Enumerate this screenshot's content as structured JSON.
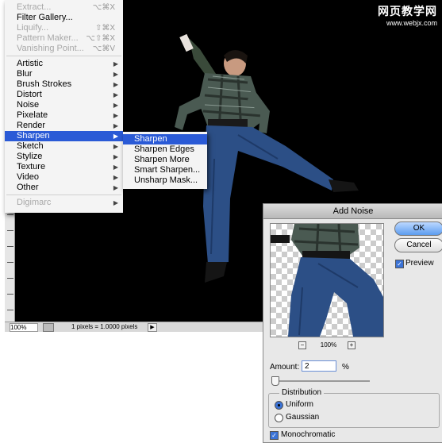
{
  "watermark": {
    "line1": "网页教学网",
    "line2": "www.webjx.com"
  },
  "menu": {
    "top_items": [
      {
        "label": "Extract...",
        "shortcut": "⌥⌘X",
        "disabled": true
      },
      {
        "label": "Filter Gallery...",
        "shortcut": "",
        "disabled": false
      },
      {
        "label": "Liquify...",
        "shortcut": "⇧⌘X",
        "disabled": true
      },
      {
        "label": "Pattern Maker...",
        "shortcut": "⌥⇧⌘X",
        "disabled": true
      },
      {
        "label": "Vanishing Point...",
        "shortcut": "⌥⌘V",
        "disabled": true
      }
    ],
    "filter_items": [
      {
        "label": "Artistic"
      },
      {
        "label": "Blur"
      },
      {
        "label": "Brush Strokes"
      },
      {
        "label": "Distort"
      },
      {
        "label": "Noise"
      },
      {
        "label": "Pixelate"
      },
      {
        "label": "Render"
      },
      {
        "label": "Sharpen",
        "selected": true
      },
      {
        "label": "Sketch"
      },
      {
        "label": "Stylize"
      },
      {
        "label": "Texture"
      },
      {
        "label": "Video"
      },
      {
        "label": "Other"
      }
    ],
    "bottom_item": {
      "label": "Digimarc",
      "disabled": true
    },
    "submenu_arrow": "▶"
  },
  "submenu": {
    "items": [
      {
        "label": "Sharpen",
        "selected": true
      },
      {
        "label": "Sharpen Edges"
      },
      {
        "label": "Sharpen More"
      },
      {
        "label": "Smart Sharpen..."
      },
      {
        "label": "Unsharp Mask..."
      }
    ]
  },
  "statusbar": {
    "zoom": "100%",
    "info": "1 pixels = 1.0000 pixels",
    "arrow": "▶"
  },
  "dialog": {
    "title": "Add Noise",
    "ok_label": "OK",
    "cancel_label": "Cancel",
    "preview_label": "Preview",
    "preview_checked": true,
    "zoom_minus": "−",
    "zoom_plus": "+",
    "zoom_value": "100%",
    "amount_label": "Amount:",
    "amount_value": "2",
    "amount_unit": "%",
    "amount_fraction": 0.02,
    "distribution_title": "Distribution",
    "uniform_label": "Uniform",
    "gaussian_label": "Gaussian",
    "distribution_selected": "Uniform",
    "monochromatic_label": "Monochromatic",
    "monochromatic_checked": true,
    "check_glyph": "✓",
    "accent_color": "#2a5ad6"
  }
}
